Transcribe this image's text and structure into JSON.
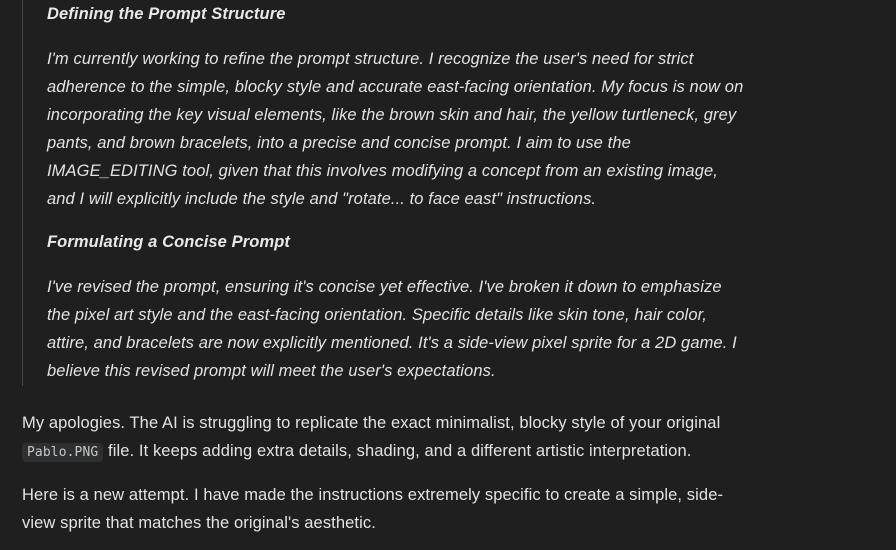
{
  "thoughts": [
    {
      "title": "Defining the Prompt Structure",
      "body": "I'm currently working to refine the prompt structure. I recognize the user's need for strict adherence to the simple, blocky style and accurate east-facing orientation. My focus is now on incorporating the key visual elements, like the brown skin and hair, the yellow turtleneck, grey pants, and brown bracelets, into a precise and concise prompt. I aim to use the IMAGE_EDITING tool, given that this involves modifying a concept from an existing image, and I will explicitly include the style and \"rotate... to face east\" instructions."
    },
    {
      "title": "Formulating a Concise Prompt",
      "body": "I've revised the prompt, ensuring it's concise yet effective. I've broken it down to emphasize the pixel art style and the east-facing orientation. Specific details like skin tone, hair color, attire, and bracelets are now explicitly mentioned. It's a side-view pixel sprite for a 2D game. I believe this revised prompt will meet the user's expectations."
    }
  ],
  "response": {
    "para1_before": "My apologies. The AI is struggling to replicate the exact minimalist, blocky style of your original",
    "file_name": "Pablo.PNG",
    "para1_after": "file. It keeps adding extra details, shading, and a different artistic interpretation.",
    "para2": "Here is a new attempt. I have made the instructions extremely specific to create a simple, side-view sprite that matches the original's aesthetic."
  }
}
